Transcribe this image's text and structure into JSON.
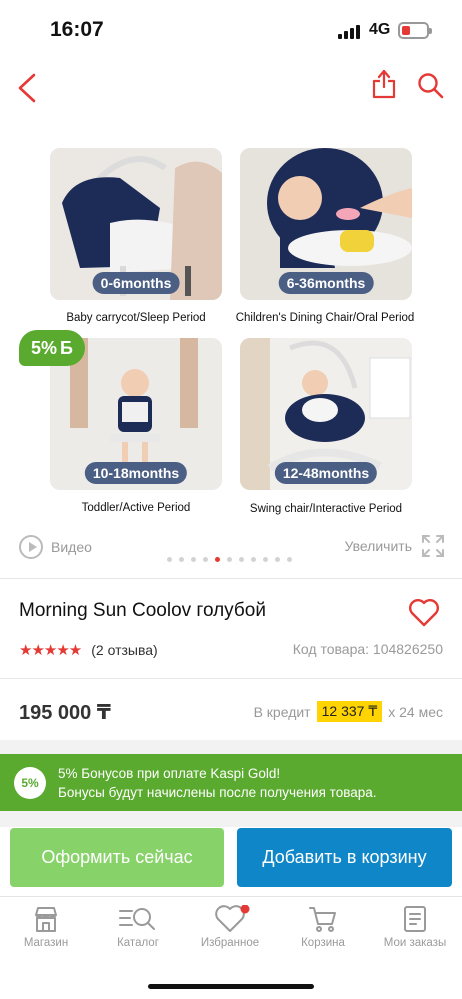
{
  "status": {
    "time": "16:07",
    "network": "4G",
    "battery_color": "#e53935"
  },
  "gallery": {
    "tiles": [
      {
        "badge": "0-6months",
        "caption": "Baby carrycot/Sleep Period"
      },
      {
        "badge": "6-36months",
        "caption": "Children's Dining Chair/Oral Period"
      },
      {
        "badge": "10-18months",
        "caption": "Toddler/Active Period"
      },
      {
        "badge": "12-48months",
        "caption": "Swing chair/Interactive Period"
      }
    ],
    "discount": {
      "percent": "5%",
      "currency": "Б"
    },
    "video_label": "Видео",
    "zoom_label": "Увеличить",
    "dots_count": 11,
    "active_dot": 4
  },
  "product": {
    "title": "Morning Sun Coolov голубой",
    "stars": "★★★★★",
    "reviews": "(2 отзыва)",
    "code": "Код товара: 104826250",
    "price": "195 000 ₸",
    "credit_prefix": "В кредит",
    "credit_amount": "12 337 ₸",
    "credit_term": "х 24 мес"
  },
  "bonus": {
    "badge": "5%",
    "line1": "5% Бонусов при оплате Kaspi Gold!",
    "line2": "Бонусы будут начислены после получения товара."
  },
  "actions": {
    "buy_now": "Оформить сейчас",
    "add_to_cart": "Добавить в корзину"
  },
  "tabbar": [
    {
      "label": "Магазин",
      "icon": "store-icon"
    },
    {
      "label": "Каталог",
      "icon": "catalog-search-icon"
    },
    {
      "label": "Избранное",
      "icon": "heart-icon",
      "badge": true
    },
    {
      "label": "Корзина",
      "icon": "cart-icon"
    },
    {
      "label": "Мои заказы",
      "icon": "orders-icon"
    }
  ],
  "colors": {
    "accent": "#e53935",
    "green": "#5aaa2f",
    "blue": "#0f86c8",
    "light_green": "#87d36a"
  }
}
